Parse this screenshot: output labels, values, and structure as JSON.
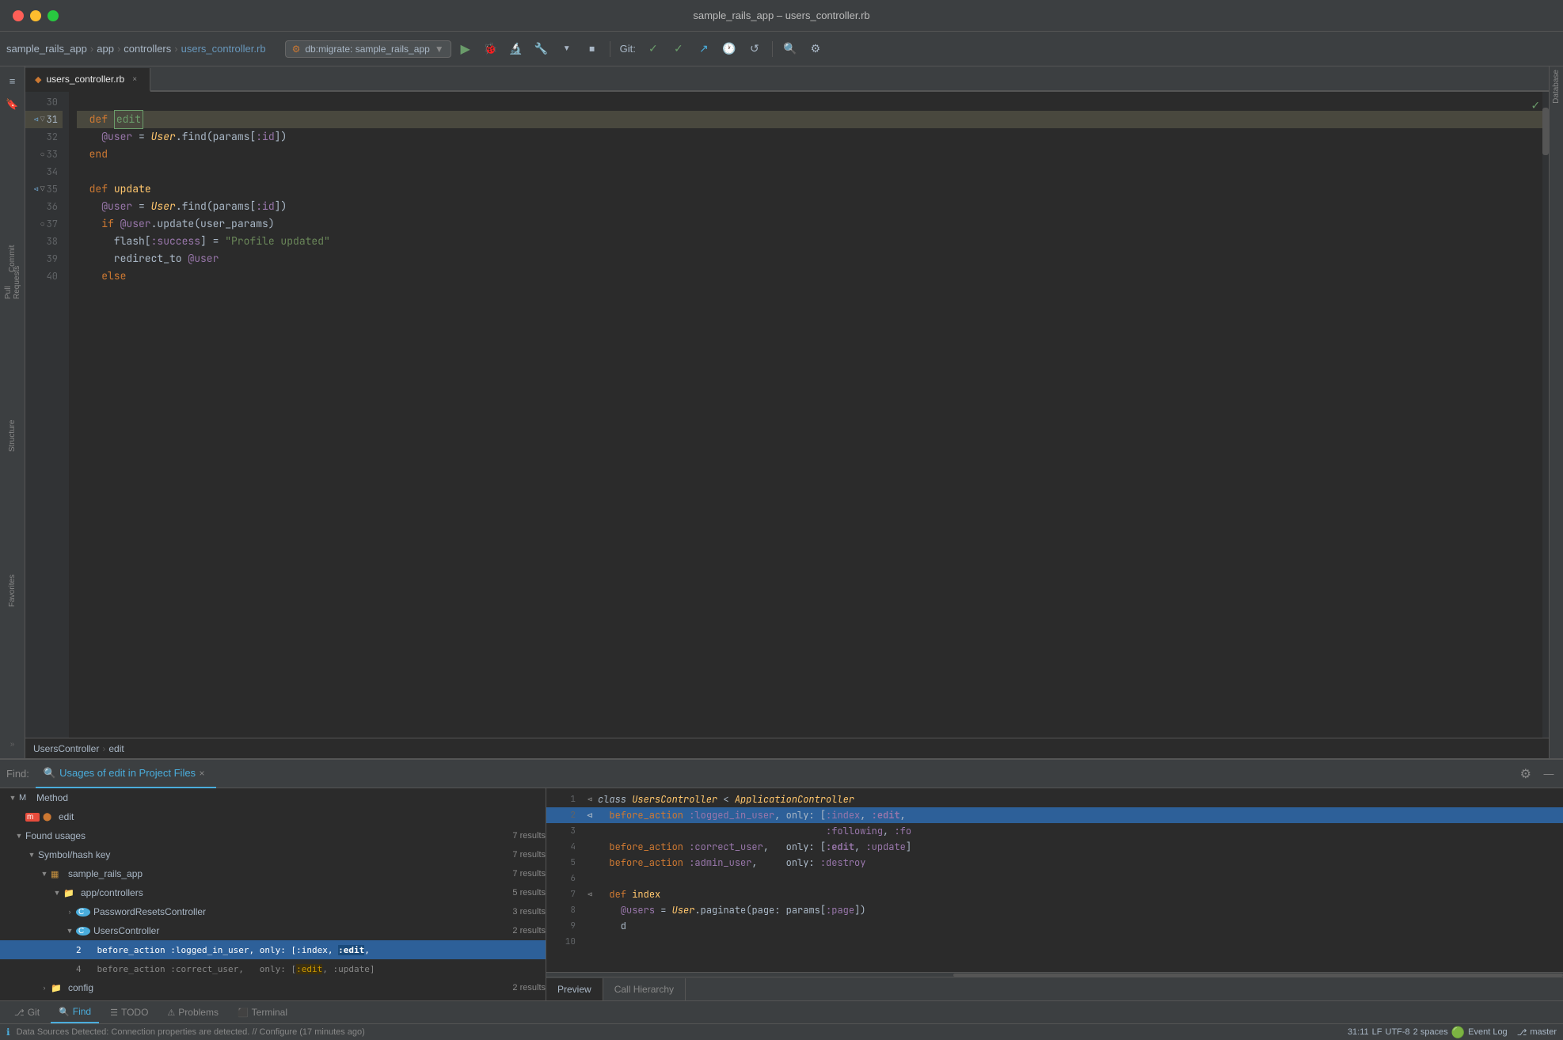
{
  "window": {
    "title": "sample_rails_app – users_controller.rb"
  },
  "titlebar": {
    "dots": [
      "red",
      "yellow",
      "green"
    ]
  },
  "toolbar": {
    "breadcrumb": {
      "project": "sample_rails_app",
      "folder1": "app",
      "folder2": "controllers",
      "file": "users_controller.rb"
    },
    "run_config": "db:migrate: sample_rails_app",
    "git_label": "Git:",
    "buttons": [
      "▶",
      "🐞",
      "⚙",
      "▣",
      "↺",
      "🔍",
      "⚙"
    ]
  },
  "editor": {
    "filename": "users_controller.rb",
    "lines": [
      {
        "num": 30,
        "content": ""
      },
      {
        "num": 31,
        "content": "  def edit",
        "highlighted": true
      },
      {
        "num": 32,
        "content": "    @user = User.find(params[:id])"
      },
      {
        "num": 33,
        "content": "  end"
      },
      {
        "num": 34,
        "content": ""
      },
      {
        "num": 35,
        "content": "  def update"
      },
      {
        "num": 36,
        "content": "    @user = User.find(params[:id])"
      },
      {
        "num": 37,
        "content": "    if @user.update(user_params)"
      },
      {
        "num": 38,
        "content": "      flash[:success] = \"Profile updated\""
      },
      {
        "num": 39,
        "content": "      redirect_to @user"
      },
      {
        "num": 40,
        "content": "    else"
      }
    ],
    "breadcrumb": {
      "class": "UsersController",
      "method": "edit"
    },
    "cursor_pos": "31:11",
    "line_ending": "LF",
    "encoding": "UTF-8",
    "indent": "2 spaces",
    "branch": "master"
  },
  "find_panel": {
    "label": "Find:",
    "tab": "Usages of edit in Project Files",
    "tree": {
      "method_label": "Method",
      "method_item": "edit",
      "found_label": "Found usages",
      "found_count": "7 results",
      "symbol_hash": "Symbol/hash key",
      "symbol_count": "7 results",
      "project": "sample_rails_app",
      "project_count": "7 results",
      "app_controllers": "app/controllers",
      "app_controllers_count": "5 results",
      "password_resets": "PasswordResetsController",
      "password_resets_count": "3 results",
      "users_controller": "UsersController",
      "users_controller_count": "2 results",
      "line2": "2   before_action :logged_in_user, only: [:index, :edit,",
      "line4": "4   before_action :correct_user,   only: [:edit, :update]",
      "config": "config",
      "config_count": "2 results"
    }
  },
  "preview": {
    "lines": [
      {
        "num": 1,
        "code": "class UsersController < ApplicationController"
      },
      {
        "num": 2,
        "code": "  before_action :logged_in_user, only: [:index, :edit,"
      },
      {
        "num": 3,
        "code": "                                        :following, :fo"
      },
      {
        "num": 4,
        "code": "  before_action :correct_user,   only: [:edit, :update]"
      },
      {
        "num": 5,
        "code": "  before_action :admin_user,     only: :destroy"
      },
      {
        "num": 6,
        "code": ""
      },
      {
        "num": 7,
        "code": "def index"
      },
      {
        "num": 8,
        "code": "  @users = User.paginate(page: params[:page])"
      },
      {
        "num": 9,
        "code": "  d"
      },
      {
        "num": 10,
        "code": ""
      }
    ],
    "tabs": [
      "Preview",
      "Call Hierarchy"
    ]
  },
  "bottom_toolbar": {
    "buttons": [
      "Git",
      "Find",
      "TODO",
      "Problems",
      "Terminal"
    ]
  },
  "status_bar": {
    "message": "Data Sources Detected: Connection properties are detected. // Configure (17 minutes ago)",
    "cursor": "31:11",
    "line_ending": "LF",
    "encoding": "UTF-8",
    "indent": "2 spaces",
    "event_log": "Event Log",
    "branch": "master"
  },
  "icons": {
    "search": "🔍",
    "gear": "⚙",
    "play": "▶",
    "debug": "🐛",
    "build": "🔨",
    "stop": "⏹",
    "refresh": "↺",
    "checkmark": "✓",
    "database": "🗄",
    "git": "⎇",
    "folder": "📁",
    "close": "×"
  }
}
